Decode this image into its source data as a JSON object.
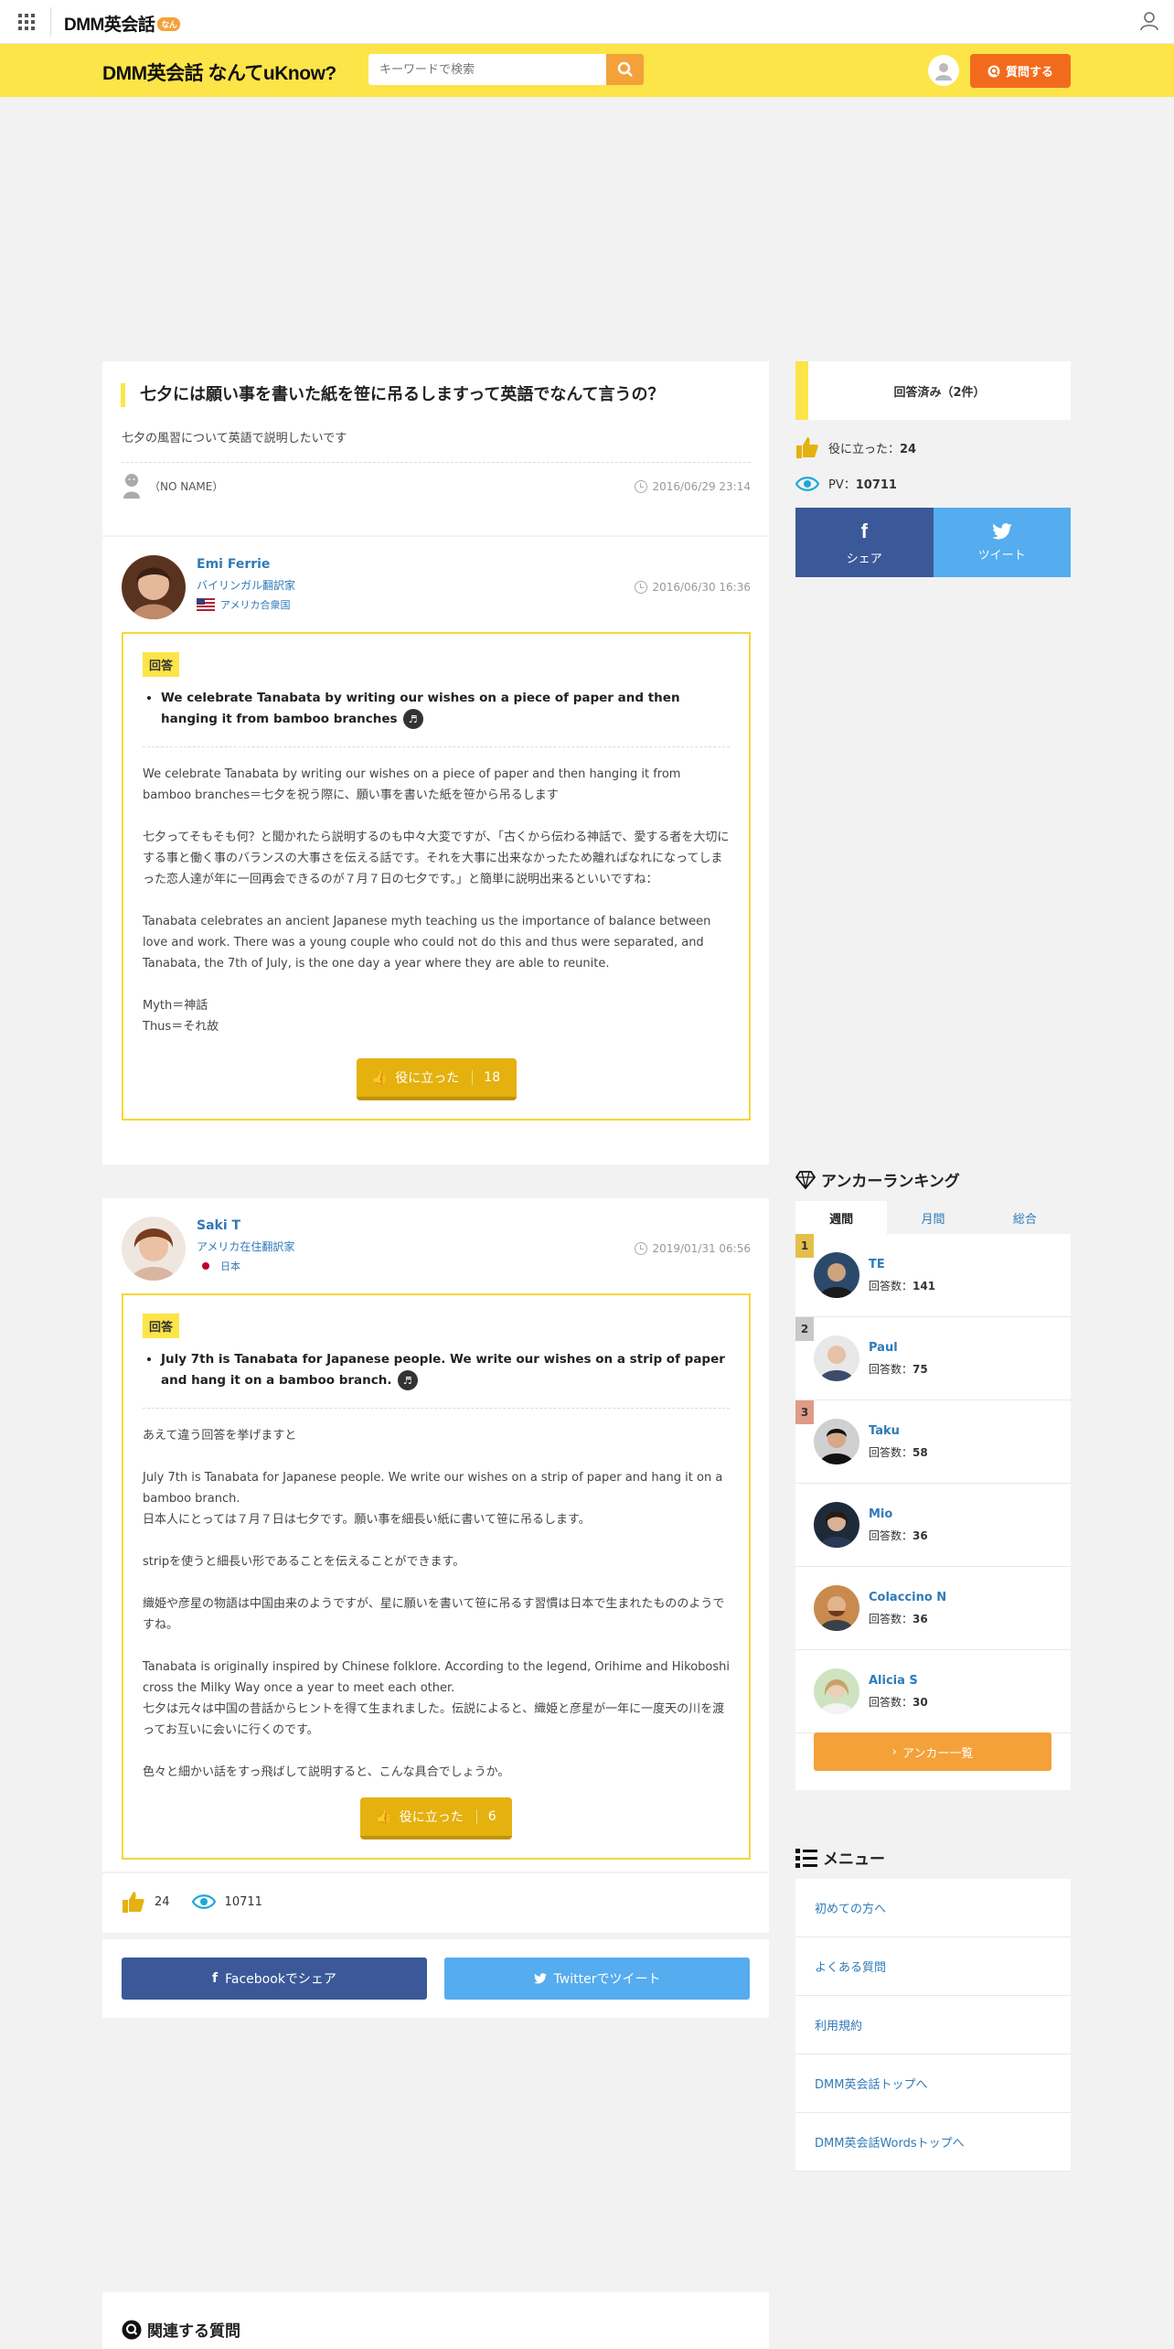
{
  "topbar": {
    "brand": "DMM英会話",
    "brand_badge": "なん"
  },
  "header": {
    "logo": "DMM英会話 なんてuKnow?",
    "search_placeholder": "キーワードで検索",
    "ask_label": "質問する"
  },
  "question": {
    "title": "七夕には願い事を書いた紙を笹に吊るしますって英語でなんて言うの？",
    "description": "七夕の風習について英語で説明したいです",
    "user": "（NO NAME）",
    "date": "2016/06/29 23:14"
  },
  "answers": [
    {
      "name": "Emi Ferrie",
      "role": "バイリンガル翻訳家",
      "country": "アメリカ合衆国",
      "date": "2016/06/30 16:36",
      "tag": "回答",
      "key_phrase": "We celebrate Tanabata by writing our wishes on a piece of paper and then hanging it from bamboo branches",
      "body": [
        "We celebrate Tanabata by writing our wishes on a piece of paper and then hanging it from bamboo branches＝七夕を祝う際に、願い事を書いた紙を笹から吊るします",
        "七夕ってそもそも何？と聞かれたら説明するのも中々大変ですが、「古くから伝わる神話で、愛する者を大切にする事と働く事のバランスの大事さを伝える話です。それを大事に出来なかったため離ればなれになってしまった恋人達が年に一回再会できるのが７月７日の七夕です。」と簡単に説明出来るといいですね：",
        "Tanabata celebrates an ancient Japanese myth teaching us the importance of balance between love and work. There was a young couple who could not do this and thus were separated, and Tanabata, the 7th of July, is the one day a year where they are able to reunite.",
        "Myth＝神話\nThus＝それ故"
      ],
      "useful_label": "役に立った",
      "useful_count": "18"
    },
    {
      "name": "Saki T",
      "role": "アメリカ在住翻訳家",
      "country": "日本",
      "date": "2019/01/31 06:56",
      "tag": "回答",
      "key_phrase": "July 7th is Tanabata for Japanese people. We write our wishes on a strip of paper and hang it on a bamboo branch.",
      "body": [
        "あえて違う回答を挙げますと",
        "July 7th is Tanabata for Japanese people. We write our wishes on a strip of paper and hang it on a bamboo branch.\n日本人にとっては７月７日は七夕です。願い事を細長い紙に書いて笹に吊るします。",
        "stripを使うと細長い形であることを伝えることができます。",
        "織姫や彦星の物語は中国由来のようですが、星に願いを書いて笹に吊るす習慣は日本で生まれたもののようですね。",
        "Tanabata is originally inspired by Chinese folklore. According to the legend, Orihime and Hikoboshi cross the Milky Way once a year to meet each other.\n七夕は元々は中国の昔話からヒントを得て生まれました。伝説によると、織姫と彦星が一年に一度天の川を渡ってお互いに会いに行くのです。",
        "色々と細かい話をすっ飛ばして説明すると、こんな具合でしょうか。"
      ],
      "useful_label": "役に立った",
      "useful_count": "6"
    }
  ],
  "stats": {
    "useful": "24",
    "views": "10711"
  },
  "share": {
    "facebook": "Facebookでシェア",
    "twitter": "Twitterでツイート"
  },
  "related_title": "関連する質問",
  "sidebar": {
    "answered": "回答済み（2件）",
    "useful_label": "役に立った：",
    "useful_value": "24",
    "pv_label": "PV：",
    "pv_value": "10711",
    "share_label": "シェア",
    "tweet_label": "ツイート",
    "ranking_title": "アンカーランキング",
    "ranking_tabs": [
      "週間",
      "月間",
      "総合"
    ],
    "count_prefix": "回答数：",
    "ranking": [
      {
        "rank": "1",
        "name": "TE",
        "count": "141"
      },
      {
        "rank": "2",
        "name": "Paul",
        "count": "75"
      },
      {
        "rank": "3",
        "name": "Taku",
        "count": "58"
      },
      {
        "rank": "",
        "name": "Mio",
        "count": "36"
      },
      {
        "rank": "",
        "name": "Colaccino N",
        "count": "36"
      },
      {
        "rank": "",
        "name": "Alicia S",
        "count": "30"
      }
    ],
    "anchor_list": "アンカー一覧",
    "menu_title": "メニュー",
    "menu": [
      "初めての方へ",
      "よくある質問",
      "利用規約",
      "DMM英会話トップへ",
      "DMM英会話Wordsトップへ"
    ]
  },
  "colors": {
    "yellow": "#fde449",
    "orange": "#f26b1c",
    "link": "#2f7ab8",
    "gold": "#e4b10f",
    "facebook": "#3b5998",
    "twitter": "#55acee"
  }
}
